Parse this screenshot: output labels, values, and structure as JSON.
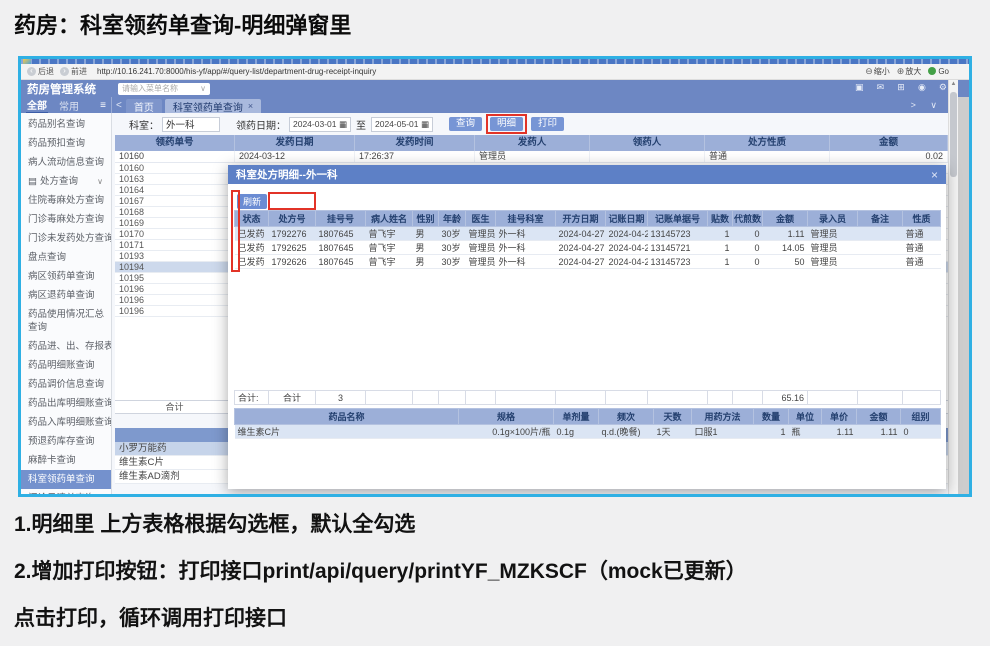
{
  "page": {
    "title": "药房：科室领药单查询-明细弹窗里",
    "notes": [
      "1.明细里 上方表格根据勾选框，默认全勾选",
      "2.增加打印按钮：打印接口print/api/query/printYF_MZKSCF（mock已更新）",
      "点击打印，循环调用打印接口"
    ]
  },
  "icons": {
    "back": "‹",
    "forward": "›",
    "zoom_out": "⊖",
    "zoom_in": "⊕",
    "monitor": "▣",
    "mail": "✉",
    "grid": "⊞",
    "clock": "◉",
    "gear": "⚙",
    "calendar": "▦",
    "chevron_down": "∨",
    "chevron_left": "<",
    "chevron_right": "> ∨",
    "hamburger": "≡",
    "doc": "▤",
    "close": "×",
    "up_arrow": "▲"
  },
  "browser": {
    "back": "后退",
    "forward": "前进",
    "url": "http://10.16.241.70:8000/his-yf/app/#/query-list/department-drug-receipt-inquiry",
    "zoom_out": "缩小",
    "zoom_in": "放大",
    "go": "Go"
  },
  "header": {
    "app_title": "药房管理系统",
    "menu_search_placeholder": "请输入菜单名称"
  },
  "sidebar": {
    "tab_all": "全部",
    "tab_common": "常用",
    "items_a": [
      "药品别名查询",
      "药品预扣查询",
      "病人流动信息查询"
    ],
    "rx_item": "处方查询",
    "items_b": [
      "住院毒麻处方查询",
      "门诊毒麻处方查询",
      "门诊未发药处方查询",
      "盘点查询",
      "病区领药单查询",
      "病区退药单查询"
    ],
    "wrap_item": "药品使用情况汇总查询",
    "items_c": [
      "药品进、出、存报表",
      "药品明细账查询",
      "药品调价信息查询",
      "药品出库明细账查询",
      "药品入库明细账查询",
      "预退药库存查询",
      "麻醉卡查询",
      "科室领药单查询",
      "门诊日清单查询"
    ],
    "selected_c_index": 7
  },
  "tabs": {
    "home": "首页",
    "active": "科室领药单查询"
  },
  "filters": {
    "dept_label": "科室：",
    "dept_value": "外一科",
    "date_label": "领药日期：",
    "date_from": "2024-03-01",
    "to_label": "至",
    "date_to": "2024-05-01",
    "btn_query": "查询",
    "btn_detail": "明细",
    "btn_print": "打印"
  },
  "main_table": {
    "headers": [
      "领药单号",
      "发药日期",
      "发药时间",
      "发药人",
      "领药人",
      "处方性质",
      "金额"
    ],
    "first_row": [
      "10160",
      "2024-03-12",
      "17:26:37",
      "管理员",
      "",
      "普通",
      "0.02"
    ],
    "order_numbers": [
      "10160",
      "10163",
      "10164",
      "10167",
      "10168",
      "10169",
      "10170",
      "10171",
      "10193",
      "10194",
      "10195",
      "10196",
      "10196",
      "10196"
    ],
    "selected_index": 9,
    "total_label": "合计"
  },
  "drug_list": {
    "items": [
      "小罗万能药",
      "维生素C片",
      "维生素AD滴剂"
    ],
    "selected_index": 0
  },
  "modal": {
    "title": "科室处方明细--外一科",
    "refresh": "刷新",
    "table": {
      "headers": [
        "状态",
        "处方号",
        "挂号号",
        "病人姓名",
        "性别",
        "年龄",
        "医生",
        "挂号科室",
        "开方日期",
        "记账日期",
        "记账单据号",
        "贴数",
        "代煎数",
        "金额",
        "录入员",
        "备注",
        "性质"
      ],
      "rows": [
        [
          "已发药",
          "1792276",
          "1807645",
          "曾飞宇",
          "男",
          "30岁",
          "管理员",
          "外一科",
          "2024-04-27",
          "2024-04-27",
          "13145723",
          "1",
          "0",
          "1.11",
          "管理员",
          "",
          "普通"
        ],
        [
          "已发药",
          "1792625",
          "1807645",
          "曾飞宇",
          "男",
          "30岁",
          "管理员",
          "外一科",
          "2024-04-27",
          "2024-04-27",
          "13145721",
          "1",
          "0",
          "14.05",
          "管理员",
          "",
          "普通"
        ],
        [
          "已发药",
          "1792626",
          "1807645",
          "曾飞宇",
          "男",
          "30岁",
          "管理员",
          "外一科",
          "2024-04-27",
          "2024-04-27",
          "13145723",
          "1",
          "0",
          "50",
          "管理员",
          "",
          "普通"
        ]
      ],
      "selected_index": 0,
      "summary": {
        "label": "合计:",
        "group": "合计",
        "count": "3",
        "amount": "65.16"
      }
    },
    "detail_table": {
      "headers": [
        "药品名称",
        "规格",
        "单剂量",
        "频次",
        "天数",
        "用药方法",
        "数量",
        "单位",
        "单价",
        "金额",
        "组别"
      ],
      "row": [
        "维生素C片",
        "0.1g×100片/瓶",
        "0.1g",
        "q.d.(晚餐)",
        "1天",
        "口服1",
        "1",
        "瓶",
        "1.11",
        "1.11",
        "0"
      ]
    }
  },
  "colors": {
    "accent_blue": "#6d87c3",
    "grid_header": "#9cafd8",
    "modal_header": "#5d80c6",
    "annotation_red": "#e23327",
    "shot_border": "#2fb0e4",
    "go_green": "#43a047",
    "selected_row": "#cdd9ec"
  }
}
